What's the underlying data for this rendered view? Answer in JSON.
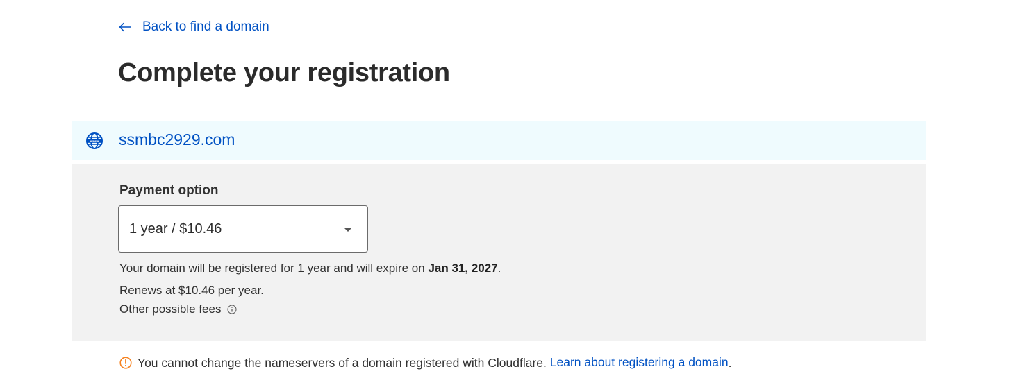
{
  "back_link": {
    "label": "Back to find a domain",
    "icon": "arrow-left-icon"
  },
  "page_title": "Complete your registration",
  "domain": {
    "name": "ssmbc2929.com",
    "icon": "globe-www-icon"
  },
  "payment": {
    "label": "Payment option",
    "selected": "1 year / $10.46",
    "expire_text": "Your domain will be registered for 1 year and will expire on",
    "expire_date": "Jan 31, 2027",
    "renews_text": "Renews at $10.46 per year.",
    "fees_label": "Other possible fees",
    "fees_icon": "info-icon"
  },
  "notice": {
    "icon": "warning-circle-icon",
    "text": "You cannot change the nameservers of a domain registered with Cloudflare.",
    "link_label": "Learn about registering a domain",
    "trailing": "."
  },
  "colors": {
    "link": "#0051c3",
    "domain_bar_bg": "#effbfe",
    "panel_bg": "#f2f2f2",
    "warning": "#f6821f"
  }
}
